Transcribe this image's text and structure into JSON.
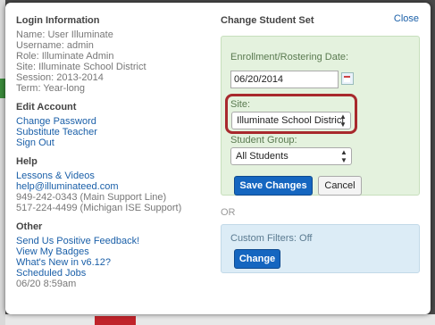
{
  "close_label": "Close",
  "login": {
    "title": "Login Information",
    "lines": [
      "Name: User Illuminate",
      "Username: admin",
      "Role: Illuminate Admin",
      "Site: Illuminate School District",
      "Session: 2013-2014",
      "Term: Year-long"
    ]
  },
  "edit_account": {
    "title": "Edit Account",
    "links": [
      "Change Password",
      "Substitute Teacher",
      "Sign Out"
    ]
  },
  "help": {
    "title": "Help",
    "links": [
      "Lessons & Videos",
      "help@illuminateed.com"
    ],
    "phones": [
      "949-242-0343 (Main Support Line)",
      "517-224-4499 (Michigan ISE Support)"
    ]
  },
  "other": {
    "title": "Other",
    "links": [
      "Send Us Positive Feedback!",
      "View My Badges",
      "What's New in v6.12?",
      "Scheduled Jobs"
    ],
    "timestamp": "06/20 8:59am"
  },
  "student_set": {
    "title": "Change Student Set",
    "enrollment_label": "Enrollment/Rostering Date:",
    "enrollment_value": "06/20/2014",
    "site_label": "Site:",
    "site_value": "Illuminate School District",
    "group_label": "Student Group:",
    "group_value": "All Students",
    "save_label": "Save Changes",
    "cancel_label": "Cancel",
    "or_label": "OR",
    "custom_filters_label": "Custom Filters: Off",
    "change_label": "Change"
  },
  "colors": {
    "link": "#1a5fa8",
    "primary_button": "#1566c0",
    "highlight_border": "#a8292d"
  }
}
